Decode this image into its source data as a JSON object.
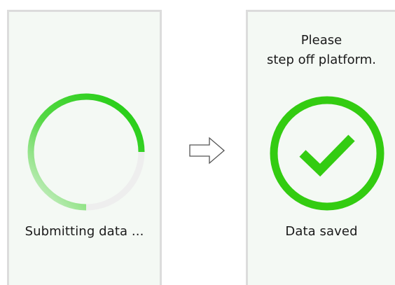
{
  "screens": {
    "submitting": {
      "status_text": "Submitting data ...",
      "progress_icon": "circular-progress-icon",
      "progress_colors": {
        "arc": "#22cc11",
        "track": "#eeeeee"
      }
    },
    "saved": {
      "prompt_line_1": "Please",
      "prompt_line_2": "step off platform.",
      "status_text": "Data saved",
      "success_icon": "checkmark-circle-icon",
      "success_color": "#33cc11"
    }
  },
  "transition_icon": "right-arrow-icon",
  "colors": {
    "panel_background": "#f4f9f4",
    "panel_border": "#dcdcdc",
    "text": "#1a1a1a"
  }
}
